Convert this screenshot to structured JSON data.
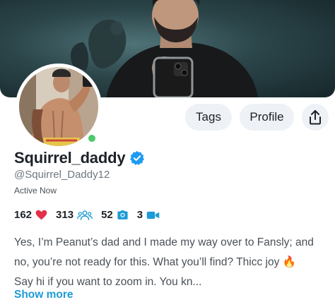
{
  "header": {
    "tags_label": "Tags",
    "profile_label": "Profile"
  },
  "profile": {
    "username": "Squirrel_daddy",
    "handle": "@Squirrel_Daddy12",
    "status": "Active Now",
    "bio_line1": "Yes, I’m Peanut’s dad and I made my way over to Fansly; and",
    "bio_line2": "no, you’re not ready for this. What you’ll find? Thicc joy 🔥",
    "bio_line3": "Say hi if you want to zoom in. You kn...",
    "show_more_label": "Show more"
  },
  "stats": {
    "likes": "162",
    "followers": "313",
    "photos": "52",
    "videos": "3"
  },
  "icons": {
    "likes": "heart-icon",
    "followers": "people-icon",
    "photos": "camera-icon",
    "videos": "video-icon",
    "share": "share-icon",
    "verified": "verified-badge-icon"
  },
  "colors": {
    "accent": "#1c9bd6",
    "heart": "#e5304a",
    "online": "#4cc96b",
    "verified": "#1d9bf0"
  }
}
